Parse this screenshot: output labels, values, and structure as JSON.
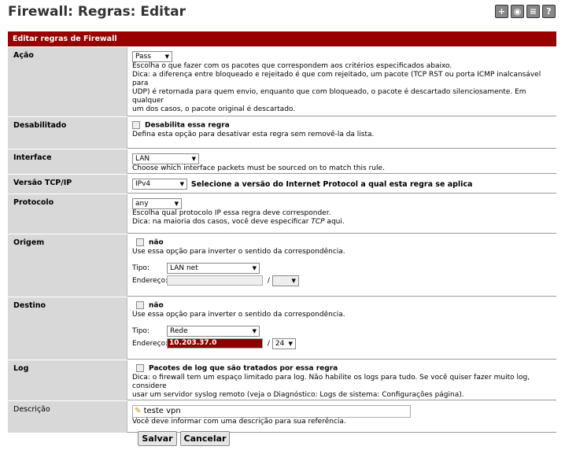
{
  "page": {
    "title": "Firewall: Regras: Editar"
  },
  "top_icons": [
    "add-icon",
    "status-icon",
    "list-icon",
    "help-icon"
  ],
  "section": {
    "title": "Editar regras de Firewall"
  },
  "acao": {
    "label": "Ação",
    "value": "Pass",
    "help1": "Escolha o que fazer com os pacotes que correspondem aos critérios especificados abaixo.",
    "help2": "Dica: a diferença entre bloqueado e rejeitado é que com rejeitado, um pacote (TCP RST ou porta ICMP inalcansável para",
    "help3": "UDP) é retornada para quem envio, enquanto que com bloqueado, o pacote é descartado silenciosamente. Em qualquer",
    "help4": "um dos casos, o pacote original é descartado."
  },
  "desabilitado": {
    "label": "Desabilitado",
    "checkbox_label": "Desabilita essa regra",
    "help": "Defina esta opção para desativar esta regra sem removê-la da lista."
  },
  "interface": {
    "label": "Interface",
    "value": "LAN",
    "help": "Choose which interface packets must be sourced on to match this rule."
  },
  "versao": {
    "label": "Versão TCP/IP",
    "value": "IPv4",
    "help": "Selecione a versão do Internet Protocol a qual esta regra se aplica"
  },
  "protocolo": {
    "label": "Protocolo",
    "value": "any",
    "help1": "Escolha qual protocolo IP essa regra deve corresponder.",
    "help2_pre": "Dica: na maioria dos casos, você deve especificar ",
    "help2_em": "TCP",
    "help2_post": " aqui."
  },
  "origem": {
    "label": "Origem",
    "checkbox_label": "não",
    "help": "Use essa opção para inverter o sentido da correspondência.",
    "tipo_label": "Tipo:",
    "tipo_value": "LAN net",
    "endereco_label": "Endereço:",
    "endereco_value": "",
    "slash": "/",
    "mask": ""
  },
  "destino": {
    "label": "Destino",
    "checkbox_label": "não",
    "help": "Use essa opção para inverter o sentido da correspondência.",
    "tipo_label": "Tipo:",
    "tipo_value": "Rede",
    "endereco_label": "Endereço:",
    "endereco_value": "10.203.37.0",
    "slash": "/",
    "mask": "24"
  },
  "log": {
    "label": "Log",
    "checkbox_label": "Pacotes de log que são tratados por essa regra",
    "help1": "Dica: o firewall tem um espaço limitado para log. Não habilite os logs para tudo. Se você quiser fazer muito log, considere",
    "help2": "usar um servidor syslog remoto (veja o Diagnóstico: Logs de sistema: Configurações página)."
  },
  "descricao": {
    "label": "Descrição",
    "value": "teste vpn",
    "help": "Você deve informar com uma descrição para sua referência."
  },
  "buttons": {
    "save": "Salvar",
    "cancel": "Cancelar"
  },
  "colors": {
    "header": "#990000",
    "label_bg": "#d8d8d8",
    "address_highlight": "#8b0000"
  }
}
